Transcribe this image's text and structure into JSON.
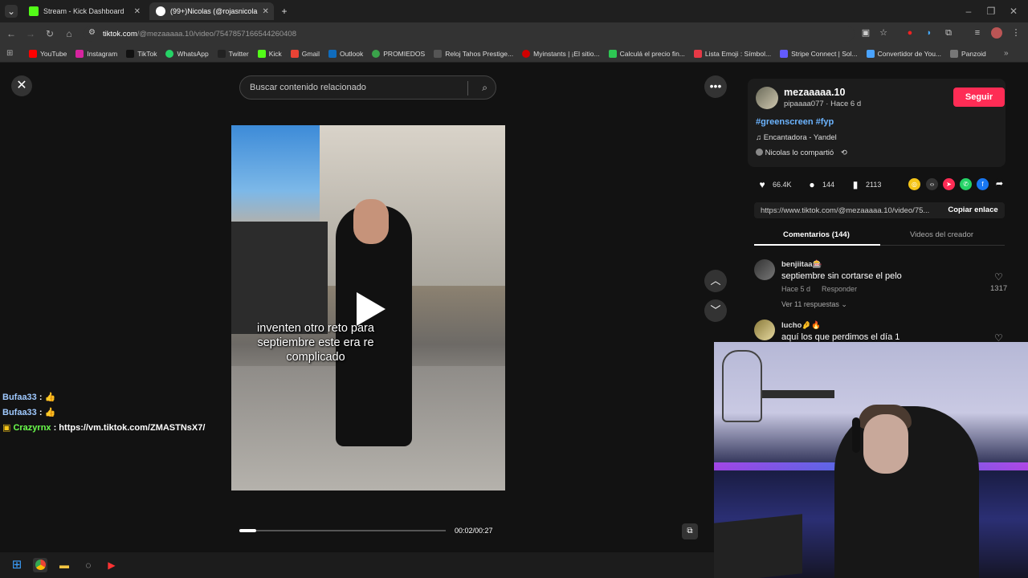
{
  "browser": {
    "tabs": [
      {
        "title": "Stream - Kick Dashboard",
        "color": "#53fc18"
      },
      {
        "title": "(99+)Nicolas (@rojasnicola",
        "color": "#ffffff"
      }
    ],
    "url_host": "tiktok.com",
    "url_path": "/@mezaaaaa.10/video/7547857166544260408",
    "bookmarks": [
      {
        "label": "YouTube",
        "color": "#ff0000"
      },
      {
        "label": "Instagram",
        "color": "#d6249f"
      },
      {
        "label": "TikTok",
        "color": "#111111"
      },
      {
        "label": "WhatsApp",
        "color": "#25d366"
      },
      {
        "label": "Twitter",
        "color": "#222222"
      },
      {
        "label": "Kick",
        "color": "#53fc18"
      },
      {
        "label": "Gmail",
        "color": "#ea4335"
      },
      {
        "label": "Outlook",
        "color": "#0f6cbd"
      },
      {
        "label": "PROMIEDOS",
        "color": "#3aa34a"
      },
      {
        "label": "Reloj Tahos Prestige...",
        "color": "#555555"
      },
      {
        "label": "Myinstants | ¡El sitio...",
        "color": "#d00000"
      },
      {
        "label": "Calculá el precio fin...",
        "color": "#2dc653"
      },
      {
        "label": "Lista Emoji : Símbol...",
        "color": "#e63946"
      },
      {
        "label": "Stripe Connect | Sol...",
        "color": "#635bff"
      },
      {
        "label": "Convertidor de You...",
        "color": "#4aa3ff"
      },
      {
        "label": "Panzoid",
        "color": "#777777"
      }
    ]
  },
  "search": {
    "placeholder": "Buscar contenido relacionado"
  },
  "video": {
    "caption": "inventen otro reto para septiembre este era re complicado",
    "time": "00:02/00:27",
    "progress": 0.08
  },
  "chat": [
    {
      "user": "Bufaa33",
      "msg": " : 👍"
    },
    {
      "user": "Bufaa33",
      "msg": " : 👍"
    },
    {
      "user": "Crazyrnx",
      "msg": " : https://vm.tiktok.com/ZMASTNsX7/"
    }
  ],
  "creator": {
    "name": "mezaaaaa.10",
    "sub": "pipaaaa077 · Hace 6 d",
    "follow_label": "Seguir",
    "hashtags": "#greenscreen #fyp",
    "music": "Encantadora - Yandel",
    "shared": "Nicolas lo compartió"
  },
  "stats": {
    "likes": "66.4K",
    "comments": "144",
    "saves": "2113"
  },
  "share_icons": [
    {
      "name": "coin-icon",
      "color": "#f5c518",
      "glyph": "◎"
    },
    {
      "name": "embed-icon",
      "color": "#333333",
      "glyph": "‹›"
    },
    {
      "name": "send-icon",
      "color": "#fe2c55",
      "glyph": "➤"
    },
    {
      "name": "whatsapp-icon",
      "color": "#25d366",
      "glyph": "✆"
    },
    {
      "name": "facebook-icon",
      "color": "#1877f2",
      "glyph": "f"
    },
    {
      "name": "share-arrow-icon",
      "color": "#121212",
      "glyph": "➦"
    }
  ],
  "link": {
    "url": "https://www.tiktok.com/@mezaaaaa.10/video/75...",
    "copy_label": "Copiar enlace"
  },
  "panel_tabs": {
    "comments": "Comentarios (144)",
    "creator_videos": "Videos del creador"
  },
  "comments": [
    {
      "user": "benjiitaa🎰",
      "text": "septiembre sin cortarse el pelo",
      "time": "Hace 5 d",
      "reply": "Responder",
      "likes": "1317",
      "replies": "Ver 11 respuestas"
    },
    {
      "user": "lucho🤌🔥",
      "text": "aquí los que perdimos el día 1"
    }
  ]
}
